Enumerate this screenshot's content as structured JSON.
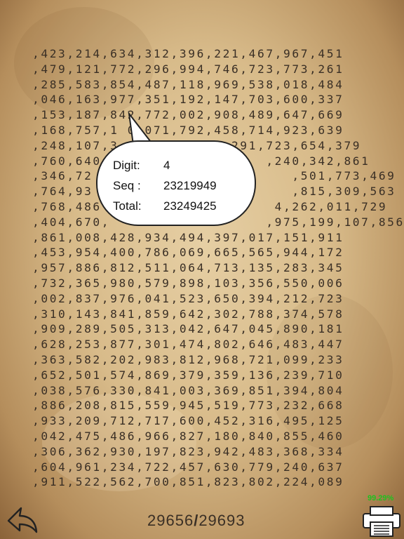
{
  "digit_rows": [
    ",423,214,634,312,396,221,467,967,451",
    ",479,121,772,296,994,746,723,773,261",
    ",285,583,854,487,118,969,538,018,484",
    ",046,163,977,351,192,147,703,600,337",
    ",153,187,842,772,002,908,489,647,669",
    ",168,757,1 0,071,792,458,714,923,639",
    ",248,107,3             291,723,654,379",
    ",760,640,                  ,240,342,861",
    ",346,72                       ,501,773,469",
    ",764,93                       ,815,309,563",
    ",768,486                    4,262,011,729",
    ",404,670,                  ,975,199,107,856",
    ",861,008,428,934,494,397,017,151,911",
    ",453,954,400,786,069,665,565,944,172",
    ",957,886,812,511,064,713,135,283,345",
    ",732,365,980,579,898,103,356,550,006",
    ",002,837,976,041,523,650,394,212,723",
    ",310,143,841,859,642,302,788,374,578",
    ",909,289,505,313,042,647,045,890,181",
    ",628,253,877,301,474,802,646,483,447",
    ",363,582,202,983,812,968,721,099,233",
    ",652,501,574,869,379,359,136,239,710",
    ",038,576,330,841,003,369,851,394,804",
    ",886,208,815,559,945,519,773,232,668",
    ",933,209,712,717,600,452,316,495,125",
    ",042,475,486,966,827,180,840,855,460",
    ",306,362,930,197,823,942,483,368,334",
    ",604,961,234,722,457,630,779,240,637",
    ",911,522,562,700,851,823,802,224,089"
  ],
  "popup": {
    "digit_label": "Digit:",
    "digit_value": "4",
    "seq_label": "Seq :",
    "seq_value": "23219949",
    "total_label": "Total:",
    "total_value": "23249425"
  },
  "footer": {
    "current_page": "29656",
    "separator": "/",
    "total_pages": "29693",
    "progress_percent": "99.29%"
  },
  "icons": {
    "back": "back-arrow-icon",
    "print": "printer-icon"
  },
  "colors": {
    "text": "#3a2f25",
    "progress": "#1ec21e"
  }
}
